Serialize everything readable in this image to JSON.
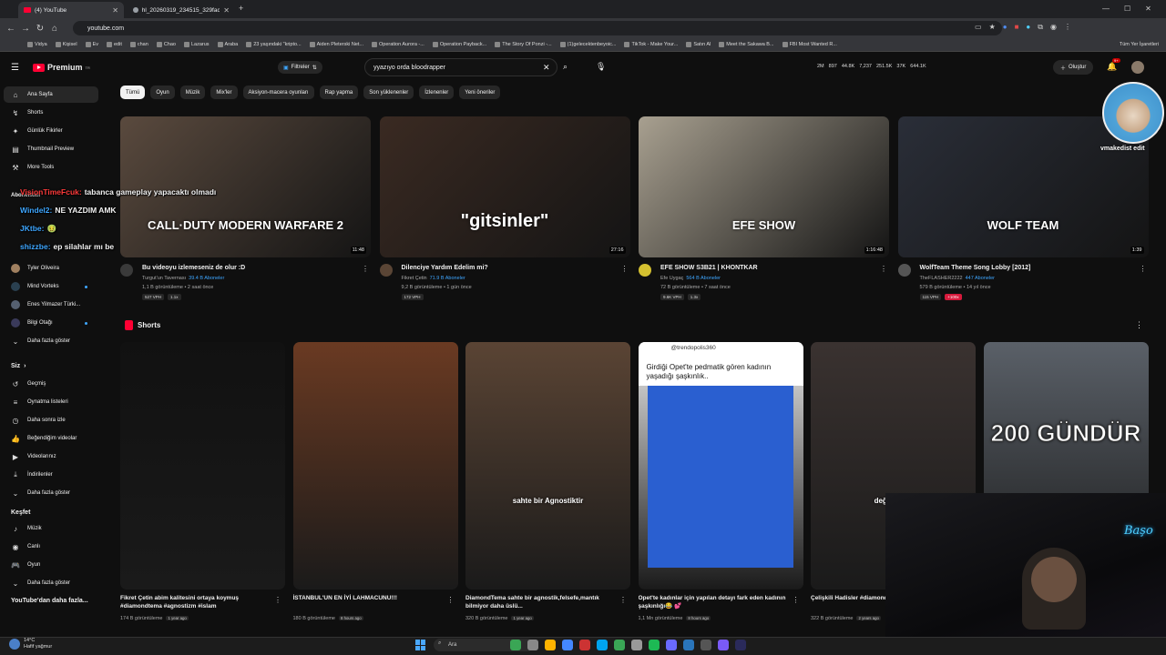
{
  "browser": {
    "tabs": [
      {
        "label": "(4) YouTube",
        "active": true
      },
      {
        "label": "hl_20260319_234515_329face5...",
        "active": false
      }
    ],
    "new_tab": "+",
    "url": "youtube.com",
    "bookmarks": [
      "Vidya",
      "Kişisel",
      "Ev",
      "edit",
      "chan",
      "Chao",
      "Lazarus",
      "Araba",
      "23 yaşındaki \"kripto...",
      "Aiden Pleterski Net...",
      "Operation Aurora -...",
      "Operation Payback...",
      "The Story Of Ponzi -...",
      "(1)gelecektenbeyoic...",
      "TikTok - Make Your...",
      "Satın Al",
      "Meet the Sakawa B...",
      "FBI Most Wanted R..."
    ],
    "all_bookmarks": "Tüm Yer İşaretleri"
  },
  "header": {
    "logo_text": "Premium",
    "logo_sup": "TR",
    "filters_label": "Filtreler",
    "search_value": "yyazıyo orda bloodrapper",
    "stats": [
      "2M",
      "897",
      "44.8K",
      "7,237",
      "251.5K",
      "37K",
      "644.1K"
    ],
    "create_label": "Oluştur",
    "bell_count": "9+",
    "colors": {
      "brand": "#ff0033",
      "bg": "#0f0f0f",
      "link": "#3ea6ff"
    }
  },
  "sidebar": {
    "main": [
      {
        "label": "Ana Sayfa",
        "icon": "home-icon",
        "active": true
      },
      {
        "label": "Shorts",
        "icon": "shorts-icon"
      },
      {
        "label": "Günlük Fikirler",
        "icon": "ideas-icon"
      },
      {
        "label": "Thumbnail Preview",
        "icon": "preview-icon"
      },
      {
        "label": "More Tools",
        "icon": "tools-icon"
      }
    ],
    "subs_heading": "Abonelikler",
    "channels": [
      {
        "label": "Tyler Oliveira",
        "dot": false
      },
      {
        "label": "Mind Vorteks",
        "dot": true
      },
      {
        "label": "Enes Yilmazer Türki...",
        "dot": false
      },
      {
        "label": "Bilgi Otağı",
        "dot": true
      }
    ],
    "channels_more": "Daha fazla göster",
    "you_heading": "Siz",
    "you": [
      {
        "label": "Geçmiş",
        "icon": "history-icon"
      },
      {
        "label": "Oynatma listeleri",
        "icon": "playlist-icon"
      },
      {
        "label": "Daha sonra izle",
        "icon": "clock-icon"
      },
      {
        "label": "Beğendiğim videolar",
        "icon": "like-icon"
      },
      {
        "label": "Videolarınız",
        "icon": "video-icon"
      },
      {
        "label": "İndirilenler",
        "icon": "download-icon"
      },
      {
        "label": "Daha fazla göster",
        "icon": "chevron-down-icon"
      }
    ],
    "explore_heading": "Keşfet",
    "explore": [
      {
        "label": "Müzik",
        "icon": "music-icon"
      },
      {
        "label": "Canlı",
        "icon": "live-icon"
      },
      {
        "label": "Oyun",
        "icon": "game-icon"
      },
      {
        "label": "Daha fazla göster",
        "icon": "chevron-down-icon"
      }
    ],
    "more_heading": "YouTube'dan daha fazla..."
  },
  "chips": [
    "Tümü",
    "Oyun",
    "Müzik",
    "Mix'ler",
    "Aksiyon-macera oyunları",
    "Rap yapma",
    "Son yüklenenler",
    "İzlenenler",
    "Yeni öneriler"
  ],
  "videos": [
    {
      "title": "Bu videoyu izlemeseniz de olur :D",
      "channel": "Turgut'un Tavernası",
      "subs": "39.4 B Aboneler",
      "meta": "1,1 B görüntüleme • 2 saat önce",
      "badges": [
        "527 VPH",
        "1.1x"
      ],
      "duration": "11:48",
      "overlay": "CALL·DUTY MODERN WARFARE 2",
      "thumb": "#5a4a3e",
      "avatar": "#3a3a3a"
    },
    {
      "title": "Dilenciye Yardım Edelim mi?",
      "channel": "Fikret Çetin",
      "subs": "71.9 B Aboneler",
      "meta": "9,2 B görüntüleme • 1 gün önce",
      "badges": [
        "172 VPH"
      ],
      "duration": "27:16",
      "overlay": "\"gitsinler\"",
      "thumb": "#3a2a22",
      "avatar": "#5a4535"
    },
    {
      "title": "EFE SHOW S3B21 | KHONTKAR",
      "channel": "Efe Uygaç",
      "subs": "564 B Aboneler",
      "meta": "72 B görüntüleme • 7 saat önce",
      "badges": [
        "9.6K VPH",
        "1.3x"
      ],
      "duration": "1:16:48",
      "overlay": "EFE SHOW",
      "thumb": "#a8a090",
      "avatar": "#d4c030"
    },
    {
      "title": "WolfTeam Theme Song Lobby [2012]",
      "channel": "TheFLASHER2222",
      "subs": "447 Aboneler",
      "meta": "579 B görüntüleme • 14 yıl önce",
      "badges": [
        "115 VPH",
        "+100x"
      ],
      "duration": "1:39",
      "overlay": "WOLF TEAM",
      "thumb": "#2a2e38",
      "avatar": "#555555"
    }
  ],
  "shorts_heading": "Shorts",
  "shorts": [
    {
      "title": "Fikret Çetin abim kalitesini ortaya koymuş #diamondtema #agnostizm #islam",
      "views": "174 B görüntüleme",
      "ago": "1 year ago",
      "thumb": "#111111",
      "overlay": ""
    },
    {
      "title": "İSTANBUL'UN EN İYİ LAHMACUNU!!!",
      "views": "180 B görüntüleme",
      "ago": "8 hours ago",
      "thumb": "#6a3a22",
      "overlay": ""
    },
    {
      "title": "DiamondTema sahte bir agnostik,felsefe,mantık bilmiyor daha üslü...",
      "views": "320 B görüntüleme",
      "ago": "1 year ago",
      "thumb": "#5a4434",
      "overlay": "sahte bir Agnostiktir"
    },
    {
      "title": "Opet'te kadınlar için yapılan detayı fark eden kadının şaşkınlığı😂 💕",
      "views": "1,1 Mn görüntüleme",
      "ago": "8 hours ago",
      "thumb": "#e8e8e8",
      "overlay": "Girdiği Opet'te pedmatik gören kadının yaşadığı şaşkınlık..",
      "handle": "@trendopolis360"
    },
    {
      "title": "Çelişkili Hadisler #diamondtema #tartışma",
      "views": "322 B görüntüleme",
      "ago": "2 years ago",
      "thumb": "#3a3230",
      "overlay": "değil adam"
    },
    {
      "title": "",
      "views": "",
      "ago": "",
      "thumb": "#5a6068",
      "overlay": "200 GÜNDÜR"
    }
  ],
  "chat": [
    {
      "user": "VisionTimeFcuk:",
      "msg": "tabanca gameplay yapacaktı olmadı",
      "red": true
    },
    {
      "user": "Windel2:",
      "msg": "NE YAZDIM AMK",
      "red": false
    },
    {
      "user": "JKtbe:",
      "msg": "🤢",
      "red": false
    },
    {
      "user": "shizzbe:",
      "msg": "ep silahlar mı be",
      "red": false
    }
  ],
  "stream_overlay": {
    "cat_name": "vmakedist edit",
    "neon": "Başo"
  },
  "taskbar": {
    "temp": "14°C",
    "weather": "Hafif yağmur",
    "search": "Ara"
  }
}
